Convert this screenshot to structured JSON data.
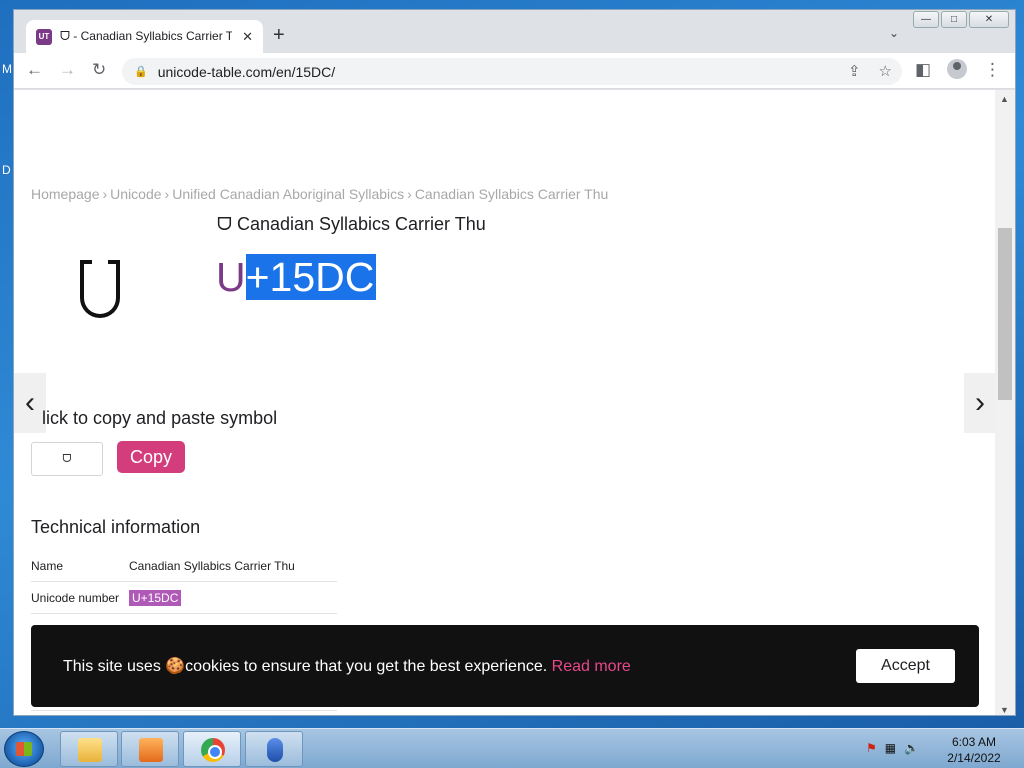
{
  "desktop": {
    "letters": [
      "M",
      "D"
    ]
  },
  "window": {
    "tab": {
      "favicon": "UT",
      "title": "ᗜ - Canadian Syllabics Carrier Th"
    },
    "controls": {
      "minimize": "—",
      "maximize": "□",
      "close": "✕"
    }
  },
  "toolbar": {
    "url": "unicode-table.com/en/15DC/",
    "icons": [
      "back-icon",
      "forward-icon",
      "reload-icon",
      "lock-icon",
      "share-icon",
      "star-icon",
      "sidepanel-icon",
      "profile-icon",
      "menu-icon"
    ]
  },
  "page": {
    "breadcrumb": [
      "Homepage",
      "Unicode",
      "Unified Canadian Aboriginal Syllabics",
      "Canadian Syllabics Carrier Thu"
    ],
    "glyph_title": "ᗜ Canadian Syllabics Carrier Thu",
    "code_prefix": "U",
    "code_selected": "+15DC",
    "copy_heading": "lick to copy and paste symbol",
    "copy_field": "ᗜ",
    "copy_button": "Copy",
    "tech_heading": "Technical information",
    "tech_rows": [
      {
        "key": "Name",
        "value": "Canadian Syllabics Carrier Thu"
      },
      {
        "key": "Unicode number",
        "value": "U+15DC"
      }
    ],
    "cookie": {
      "text": "This site uses 🍪cookies to ensure that you get the best experience.",
      "link": "Read more",
      "accept": "Accept"
    }
  },
  "taskbar": {
    "time": "6:03 AM",
    "date": "2/14/2022"
  },
  "colors": {
    "accent": "#d33d7c",
    "code": "#7b3a87",
    "selection": "#1a73e8"
  }
}
